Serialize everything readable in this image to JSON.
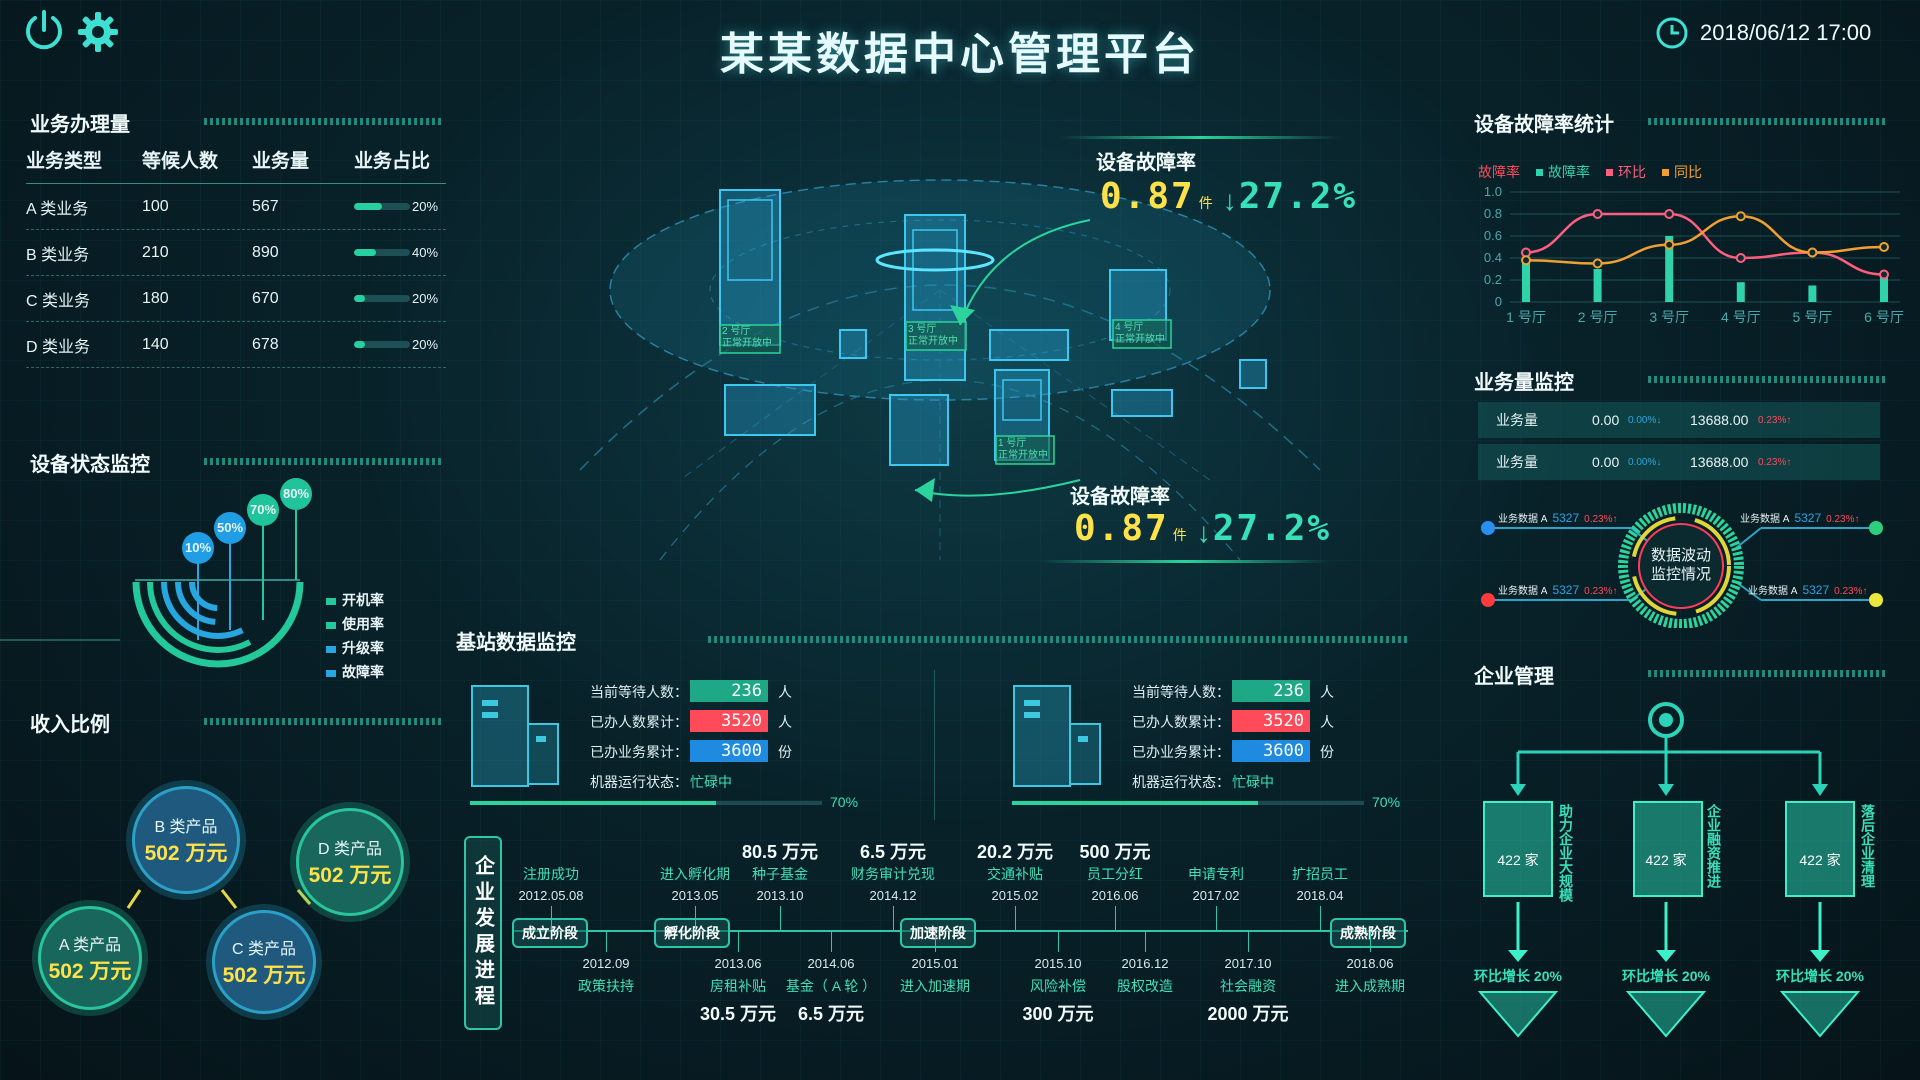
{
  "header": {
    "title": "某某数据中心管理平台",
    "datetime": "2018/06/12 17:00"
  },
  "biz": {
    "title": "业务办理量",
    "columns": [
      "业务类型",
      "等候人数",
      "业务量",
      "业务占比"
    ],
    "rows": [
      {
        "type": "A 类业务",
        "waiting": "100",
        "volume": "567",
        "share": "20%",
        "share_value": 0.5
      },
      {
        "type": "B 类业务",
        "waiting": "210",
        "volume": "890",
        "share": "40%",
        "share_value": 0.4
      },
      {
        "type": "C 类业务",
        "waiting": "180",
        "volume": "670",
        "share": "20%",
        "share_value": 0.2
      },
      {
        "type": "D 类业务",
        "waiting": "140",
        "volume": "678",
        "share": "20%",
        "share_value": 0.2
      }
    ]
  },
  "device_status": {
    "title": "设备状态监控",
    "bubbles": [
      "10%",
      "50%",
      "70%",
      "80%"
    ],
    "legend": [
      "开机率",
      "使用率",
      "升级率",
      "故障率"
    ]
  },
  "income": {
    "title": "收入比例",
    "items": [
      {
        "name": "B 类产品",
        "value": "502 万元"
      },
      {
        "name": "D 类产品",
        "value": "502 万元"
      },
      {
        "name": "A 类产品",
        "value": "502 万元"
      },
      {
        "name": "C 类产品",
        "value": "502 万元"
      }
    ]
  },
  "center": {
    "kpi1": {
      "label": "设备故障率",
      "value": "0.87",
      "unit": "件",
      "change": "27.2%"
    },
    "kpi2": {
      "label": "设备故障率",
      "value": "0.87",
      "unit": "件",
      "change": "27.2%"
    },
    "buildings": [
      {
        "hall": "2 号厅",
        "status": "正常开放中"
      },
      {
        "hall": "3 号厅",
        "status": "正常开放中"
      },
      {
        "hall": "4 号厅",
        "status": "正常开放中"
      },
      {
        "hall": "1 号厅",
        "status": "正常开放中"
      }
    ]
  },
  "station": {
    "title": "基站数据监控",
    "panels": [
      {
        "waiting_label": "当前等待人数：",
        "waiting": "236",
        "waiting_unit": "人",
        "done_label": "已办人数累计：",
        "done": "3520",
        "done_unit": "人",
        "biz_label": "已办业务累计：",
        "biz": "3600",
        "biz_unit": "份",
        "status_label": "机器运行状态：",
        "status": "忙碌中",
        "progress": "70%",
        "progress_value": 0.7
      },
      {
        "waiting_label": "当前等待人数：",
        "waiting": "236",
        "waiting_unit": "人",
        "done_label": "已办人数累计：",
        "done": "3520",
        "done_unit": "人",
        "biz_label": "已办业务累计：",
        "biz": "3600",
        "biz_unit": "份",
        "status_label": "机器运行状态：",
        "status": "忙碌中",
        "progress": "70%",
        "progress_value": 0.7
      }
    ]
  },
  "timeline": {
    "title": "企业发展进程",
    "stages": [
      "成立阶段",
      "孵化阶段",
      "加速阶段",
      "成熟阶段"
    ],
    "top_events": [
      {
        "event": "注册成功",
        "date": "2012.05.08",
        "amount": ""
      },
      {
        "event": "进入孵化期",
        "date": "2013.05",
        "amount": ""
      },
      {
        "event": "种子基金",
        "date": "2013.10",
        "amount": "80.5 万元"
      },
      {
        "event": "财务审计兑现",
        "date": "2014.12",
        "amount": "6.5 万元"
      },
      {
        "event": "交通补贴",
        "date": "2015.02",
        "amount": "20.2 万元"
      },
      {
        "event": "员工分红",
        "date": "2016.06",
        "amount": "500 万元"
      },
      {
        "event": "申请专利",
        "date": "2017.02",
        "amount": ""
      },
      {
        "event": "扩招员工",
        "date": "2018.04",
        "amount": ""
      }
    ],
    "bottom_events": [
      {
        "date": "2012.09",
        "event": "政策扶持",
        "amount": ""
      },
      {
        "date": "2013.06",
        "event": "房租补贴",
        "amount": "30.5 万元"
      },
      {
        "date": "2014.06",
        "event": "基金（ A 轮 ）",
        "amount": "6.5 万元"
      },
      {
        "date": "2015.01",
        "event": "进入加速期",
        "amount": ""
      },
      {
        "date": "2015.10",
        "event": "风险补偿",
        "amount": "300 万元"
      },
      {
        "date": "2016.12",
        "event": "股权改造",
        "amount": ""
      },
      {
        "date": "2017.10",
        "event": "社会融资",
        "amount": "2000 万元"
      },
      {
        "date": "2018.06",
        "event": "进入成熟期",
        "amount": ""
      }
    ]
  },
  "fault_stats": {
    "title": "设备故障率统计",
    "legend": [
      {
        "name": "故障率",
        "color": "#ff4a5a"
      },
      {
        "name": "故障率",
        "color": "#2fd3a9"
      },
      {
        "name": "环比",
        "color": "#ff5e7e"
      },
      {
        "name": "同比",
        "color": "#f0a030"
      }
    ]
  },
  "chart_data": {
    "type": "line",
    "categories": [
      "1 号厅",
      "2 号厅",
      "3 号厅",
      "4 号厅",
      "5 号厅",
      "6 号厅"
    ],
    "yticks": [
      "0",
      "0.2",
      "0.4",
      "0.6",
      "0.8",
      "1.0"
    ],
    "ylim": [
      0,
      1.0
    ],
    "series": [
      {
        "name": "故障率",
        "type": "bar",
        "values": [
          0.4,
          0.3,
          0.6,
          0.18,
          0.15,
          0.25
        ],
        "color": "#2fd3a9"
      },
      {
        "name": "环比",
        "type": "line",
        "values": [
          0.45,
          0.8,
          0.8,
          0.4,
          0.45,
          0.25
        ],
        "color": "#ff5e7e"
      },
      {
        "name": "同比",
        "type": "line",
        "values": [
          0.38,
          0.35,
          0.52,
          0.78,
          0.45,
          0.5
        ],
        "color": "#f0a030"
      }
    ]
  },
  "biz_monitor": {
    "title": "业务量监控",
    "rows": [
      {
        "label": "业务量",
        "v1": "0.00",
        "p1": "0.00%↓",
        "v2": "13688.00",
        "p2": "0.23%↑"
      },
      {
        "label": "业务量",
        "v1": "0.00",
        "p1": "0.00%↓",
        "v2": "13688.00",
        "p2": "0.23%↑"
      }
    ],
    "ring_title": "数据波动\n监控情况",
    "nodes": [
      {
        "label": "业务数据 A",
        "value": "5327",
        "pct": "0.23%↑",
        "color": "#2a8ff0"
      },
      {
        "label": "业务数据 A",
        "value": "5327",
        "pct": "0.23%↑",
        "color": "#2ccf7a"
      },
      {
        "label": "业务数据 A",
        "value": "5327",
        "pct": "0.23%↑",
        "color": "#ff3b3b"
      },
      {
        "label": "业务数据 A",
        "value": "5327",
        "pct": "0.23%↑",
        "color": "#e9e83a"
      }
    ]
  },
  "enterprise": {
    "title": "企业管理",
    "columns": [
      {
        "count": "422 家",
        "side": "助力企业大规模",
        "growth": "环比增长 20%"
      },
      {
        "count": "422 家",
        "side": "企业融资推进",
        "growth": "环比增长 20%"
      },
      {
        "count": "422 家",
        "side": "落后企业清理",
        "growth": "环比增长 20%"
      }
    ]
  }
}
